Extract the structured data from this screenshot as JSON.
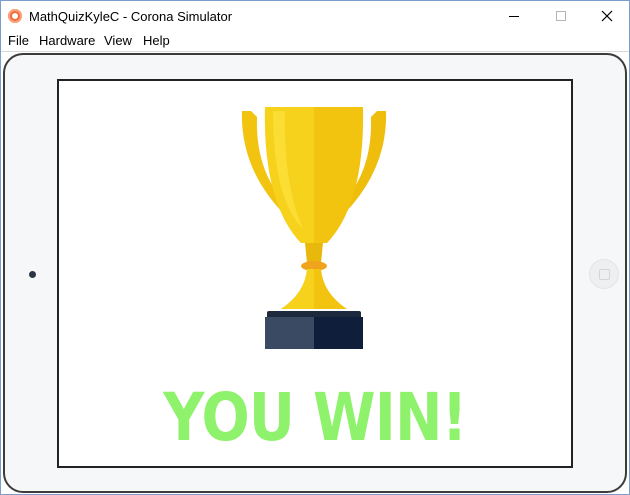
{
  "window": {
    "title": "MathQuizKyleC - Corona Simulator"
  },
  "menu": {
    "items": [
      "File",
      "Hardware",
      "View",
      "Help"
    ]
  },
  "screen": {
    "message": "YOU WIN!",
    "message_color": "#8ef26c",
    "image": "trophy-icon"
  },
  "colors": {
    "trophy_gold": "#f2c40f",
    "trophy_highlight": "#fde03a",
    "trophy_base": "#2a3b55",
    "device_frame": "#f6f7f8"
  }
}
